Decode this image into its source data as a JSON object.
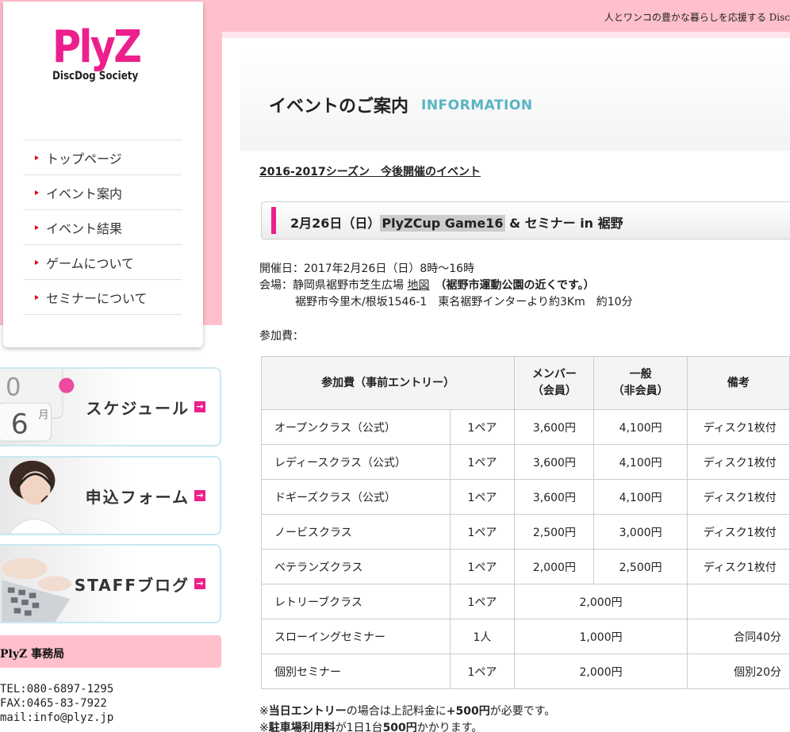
{
  "header": {
    "tagline": "人とワンコの豊かな暮らしを応援する Disc"
  },
  "logo": {
    "main": "PlyZ",
    "sub": "DiscDog Society"
  },
  "nav": [
    {
      "label": "トップページ"
    },
    {
      "label": "イベント案内"
    },
    {
      "label": "イベント結果"
    },
    {
      "label": "ゲームについて"
    },
    {
      "label": "セミナーについて"
    }
  ],
  "banners": [
    {
      "label": "スケジュール",
      "icon": "calendar-icon"
    },
    {
      "label": "申込フォーム",
      "icon": "headset-operator-icon"
    },
    {
      "label": "STAFFブログ",
      "icon": "keyboard-icon"
    }
  ],
  "office": {
    "title": "PlyZ 事務局",
    "tel": "TEL:080-6897-1295",
    "fax": "FAX:0465-83-7922",
    "mail": "mail:info@plyz.jp"
  },
  "page": {
    "title_jp": "イベントのご案内",
    "title_en": "INFORMATION",
    "season": "2016-2017シーズン　今後開催のイベント"
  },
  "event": {
    "date": "2月26日（日）",
    "name": "PlyZCup Game16",
    "rest": " & セミナー in 裾野",
    "date_line": "開催日：2017年2月26日（日）8時〜16時",
    "venue_prefix": "会場：静岡県裾野市芝生広場 ",
    "map_link": "地図",
    "venue_note": "　（裾野市運動公園の近くです。）",
    "address": "裾野市今里木/根坂1546-1　東名裾野インターより約3Km　約10分",
    "fee_label": "参加費："
  },
  "fee_table": {
    "headers": {
      "entry": "参加費（事前エントリー）",
      "member_1": "メンバー",
      "member_2": "（会員）",
      "general_1": "一般",
      "general_2": "（非会員）",
      "notes": "備考"
    },
    "rows": [
      {
        "class": "オープンクラス（公式）",
        "unit": "1ペア",
        "member": "3,600円",
        "general": "4,100円",
        "note": "ディスク1枚付"
      },
      {
        "class": "レディースクラス（公式）",
        "unit": "1ペア",
        "member": "3,600円",
        "general": "4,100円",
        "note": "ディスク1枚付"
      },
      {
        "class": "ドギーズクラス（公式）",
        "unit": "1ペア",
        "member": "3,600円",
        "general": "4,100円",
        "note": "ディスク1枚付"
      },
      {
        "class": "ノービスクラス",
        "unit": "1ペア",
        "member": "2,500円",
        "general": "3,000円",
        "note": "ディスク1枚付"
      },
      {
        "class": "ベテランズクラス",
        "unit": "1ペア",
        "member": "2,000円",
        "general": "2,500円",
        "note": "ディスク1枚付"
      }
    ],
    "merged_rows": [
      {
        "class": "レトリーブクラス",
        "unit": "1ペア",
        "price": "2,000円",
        "note": ""
      },
      {
        "class": "スローイングセミナー",
        "unit": "1人",
        "price": "1,000円",
        "note": "合同40分"
      },
      {
        "class": "個別セミナー",
        "unit": "1ペア",
        "price": "2,000円",
        "note": "個別20分"
      }
    ]
  },
  "notes": {
    "n1_a": "※",
    "n1_b": "当日エントリー",
    "n1_c": "の場合は上記料金に",
    "n1_d": "+500円",
    "n1_e": "が必要です。",
    "n2_a": "※",
    "n2_b": "駐車場利用料",
    "n2_c": "が1日1台",
    "n2_d": "500円",
    "n2_e": "かかります。"
  }
}
